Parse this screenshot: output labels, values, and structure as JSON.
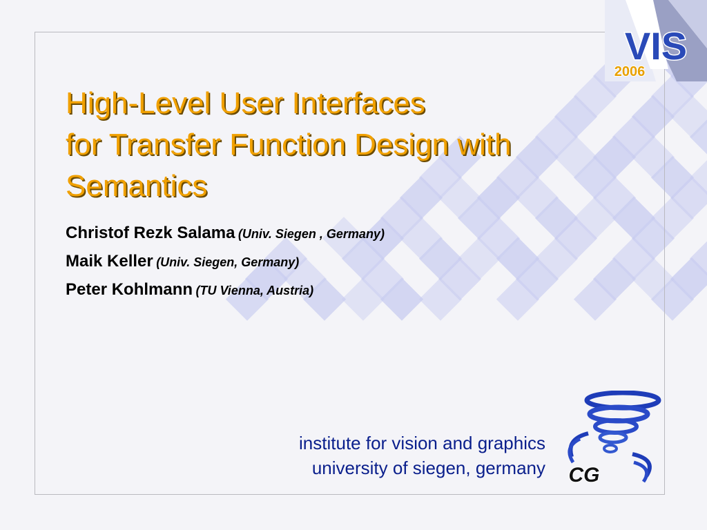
{
  "slide": {
    "title_lines": [
      "High-Level User Interfaces",
      "for Transfer Function Design with",
      "Semantics"
    ],
    "authors": [
      {
        "name": "Christof Rezk Salama",
        "affiliation": "(Univ. Siegen , Germany)"
      },
      {
        "name": "Maik Keller",
        "affiliation": "(Univ. Siegen, Germany)"
      },
      {
        "name": "Peter Kohlmann",
        "affiliation": "(TU Vienna, Austria)"
      }
    ],
    "institute_lines": [
      "institute for vision and graphics",
      "university of siegen, germany"
    ]
  },
  "logos": {
    "vis": {
      "text": "VIS",
      "year": "2006"
    },
    "cg": {
      "text": "CG"
    }
  },
  "colors": {
    "title": "#f0a000",
    "institute_text": "#0a1f8c",
    "tile": "#c8ccf0"
  }
}
